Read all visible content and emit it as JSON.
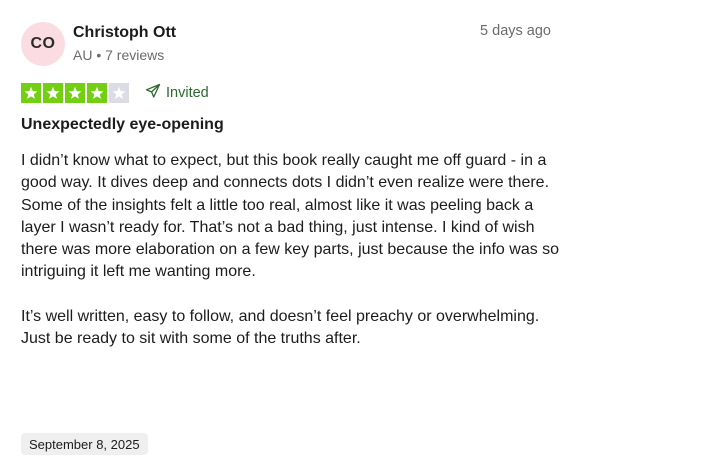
{
  "review": {
    "author": {
      "initials": "CO",
      "name": "Christoph Ott",
      "meta": "AU • 7 reviews"
    },
    "posted_ago": "5 days ago",
    "rating": {
      "stars": 4,
      "max": 5
    },
    "badge": {
      "label": "Invited",
      "icon": "send-icon"
    },
    "title": "Unexpectedly eye-opening",
    "paragraphs": [
      "I didn’t know what to expect, but this book really caught me off guard - in a good way. It dives deep and connects dots I didn’t even realize were there. Some of the insights felt a little too real, almost like it was peeling back a layer I wasn’t ready for. That’s not a bad thing, just intense. I kind of wish there was more elaboration on a few key parts, just because the info was so intriguing it left me wanting more.",
      "It’s well written, easy to follow, and doesn’t feel preachy or overwhelming. Just be ready to sit with some of the truths after."
    ],
    "experience_date": "September 8, 2025"
  },
  "colors": {
    "star_filled": "#73cf11",
    "star_empty": "#dcdce6",
    "avatar_bg": "#fbdce3",
    "invited_text": "#2a6a2e"
  }
}
